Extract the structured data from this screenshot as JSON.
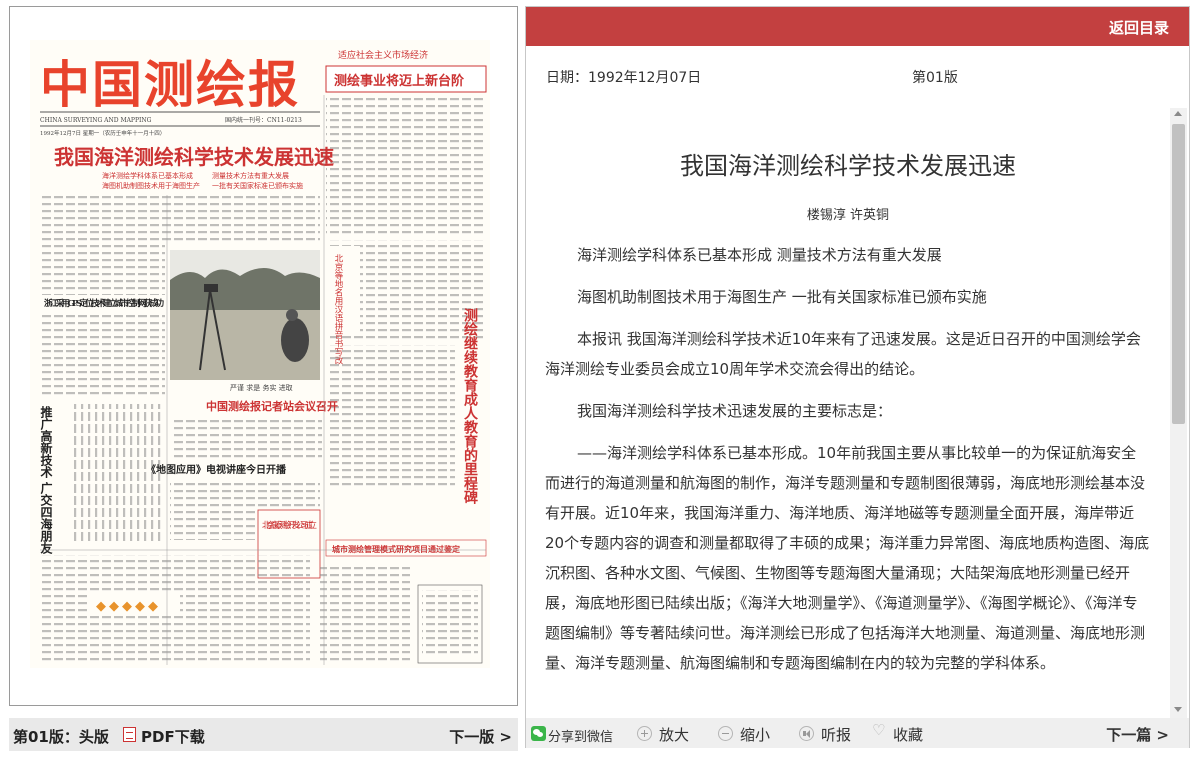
{
  "left_panel": {
    "page_label": "第01版：头版",
    "pdf_label": "PDF下载",
    "next_page_label": "下一版 >",
    "newspaper": {
      "masthead": "中国测绘报",
      "english_name": "CHINA SURVEYING AND MAPPING",
      "issue_line": "1992年12月7日 星期一（农历壬申年十一月十四）",
      "code_line": "国内统一刊号：CN11-0213",
      "slogan": "适应社会主义市场经济",
      "top_box": "测绘事业将迈上新台阶",
      "main_headline": "我国海洋测绘科学技术发展迅速",
      "sub_lines": [
        "海洋测绘学科体系已基本形成",
        "海图机助制图技术用于海图生产",
        "测量技术方法有重大发展",
        "一批有关国家标准已颁布实施"
      ],
      "headline_zhejiang": "浙江采用GPS定位技术建立城市控制网获成功",
      "headline_reporters": "中国测绘报记者站会议召开",
      "headline_tv": "《地图应用》电视讲座今日开播",
      "headline_beijing": "北京康泰测绘开发公司成立",
      "headline_management": "城市测绘管理模式研究项目通过鉴定",
      "vertical_education": "测绘继续教育成人教育的里程碑",
      "vertical_promote": "推广高新技术 广交四海朋友",
      "photo_caption": "严谨 求是 务实 进取",
      "vertical_box": "北京等地名用汉语拼音书写改"
    }
  },
  "right_panel": {
    "return_label": "返回目录",
    "date_label": "日期：1992年12月07日",
    "edition_label": "第01版",
    "article": {
      "title": "我国海洋测绘科学技术发展迅速",
      "authors": "楼锡淳 许英铜",
      "paragraphs": [
        "海洋测绘学科体系已基本形成 测量技术方法有重大发展",
        "海图机助制图技术用于海图生产 一批有关国家标准已颁布实施",
        "本报讯 我国海洋测绘科学技术近10年来有了迅速发展。这是近日召开的中国测绘学会海洋测绘专业委员会成立10周年学术交流会得出的结论。",
        "我国海洋测绘科学技术迅速发展的主要标志是：",
        "——海洋测绘学科体系已基本形成。10年前我国主要从事比较单一的为保证航海安全而进行的海道测量和航海图的制作，海洋专题测量和专题制图很薄弱，海底地形测绘基本没有开展。近10年来，我国海洋重力、海洋地质、海洋地磁等专题测量全面开展，海岸带近20个专题内容的调查和测量都取得了丰硕的成果；海洋重力异常图、海底地质构造图、海底沉积图、各种水文图、气候图、生物图等专题海图大量涌现；大陆架海底地形测量已经开展，海底地形图已陆续出版；《海洋大地测量学》、《海道测量学》、《海图学概论》、《海洋专题图编制》等专著陆续问世。海洋测绘已形成了包括海洋大地测量、海道测量、海底地形测量、海洋专题测量、航海图编制和专题海图编制在内的较为完整的学科体系。"
      ]
    },
    "toolbar": {
      "wechat_label": "分享到微信",
      "zoom_in_label": "放大",
      "zoom_out_label": "缩小",
      "listen_label": "听报",
      "favorite_label": "收藏",
      "next_article_label": "下一篇 >"
    }
  },
  "colors": {
    "accent_red": "#c34040",
    "masthead_red": "#e8432c",
    "toolbar_gray": "#efefef",
    "left_bar_gray": "#e9e9e9"
  },
  "icons": [
    "pdf-icon",
    "wechat-icon",
    "zoom-in-icon",
    "zoom-out-icon",
    "speaker-icon",
    "heart-icon"
  ]
}
